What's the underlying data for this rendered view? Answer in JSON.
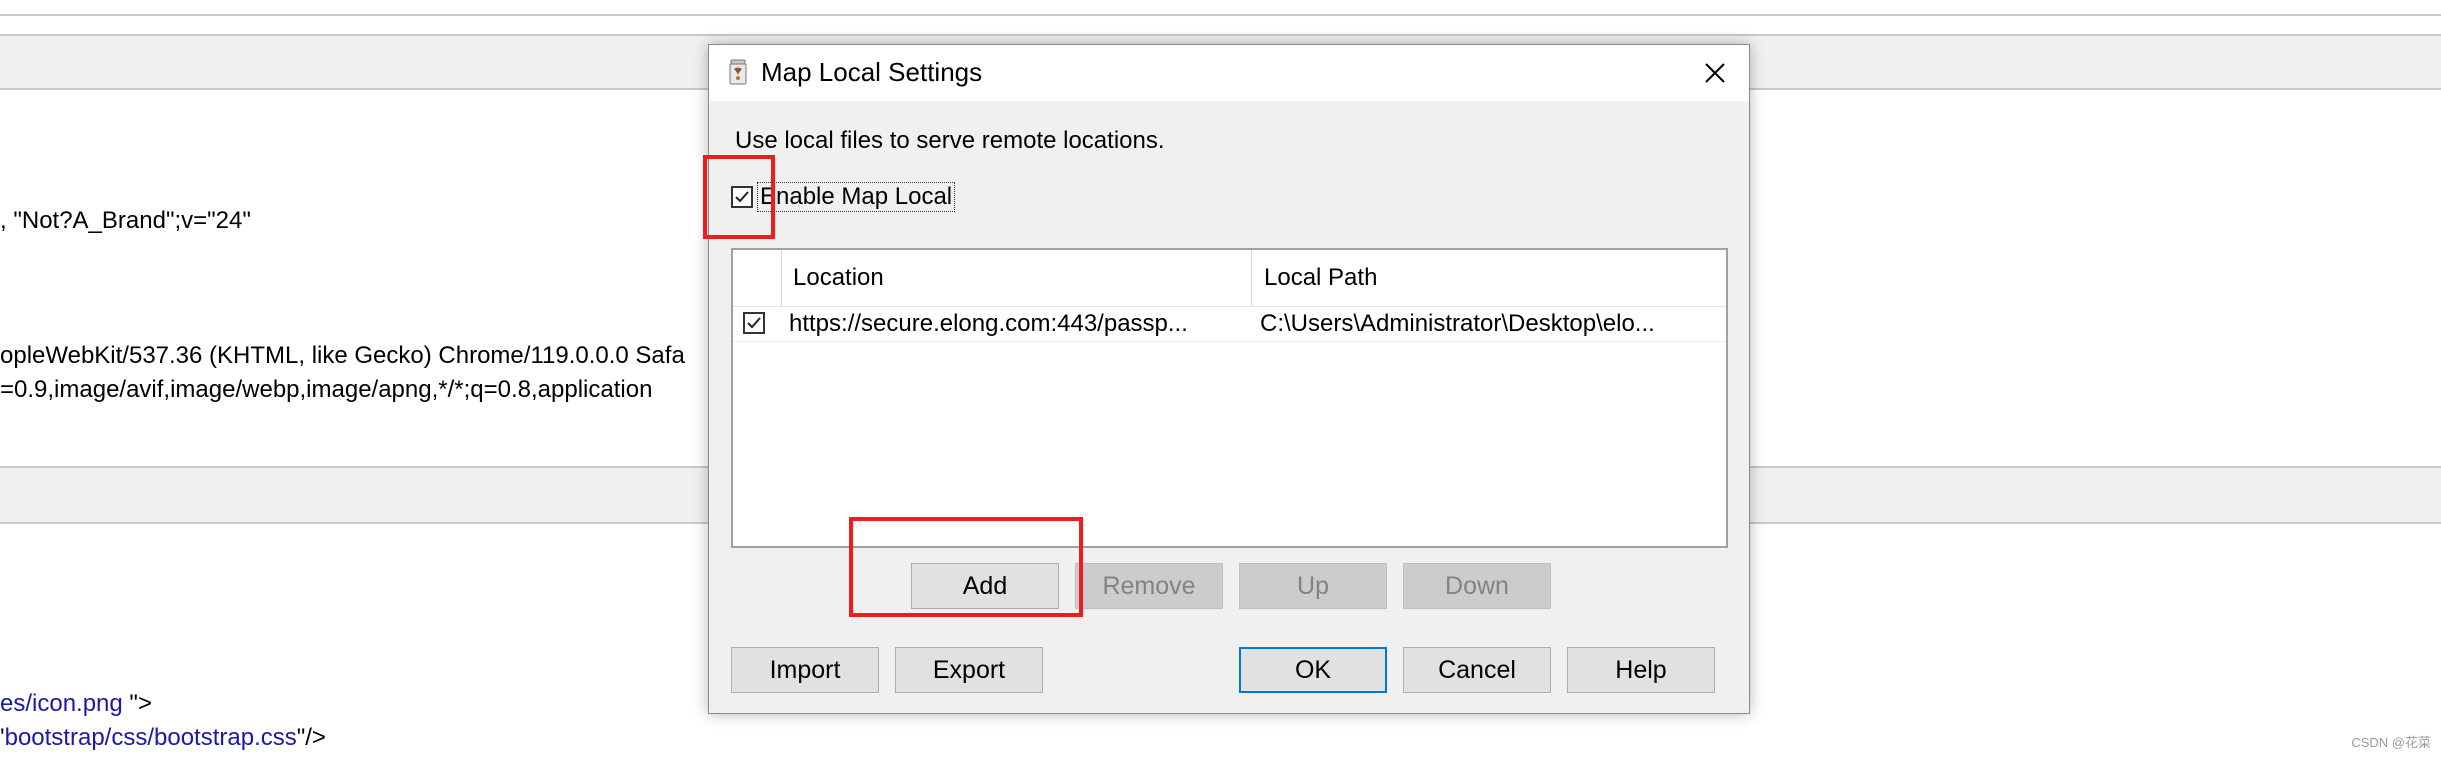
{
  "background": {
    "lines": [
      ", \"Not?A_Brand\";v=\"24\"",
      "opleWebKit/537.36 (KHTML, like Gecko) Chrome/119.0.0.0 Safa",
      "=0.9,image/avif,image/webp,image/apng,*/*;q=0.8,application"
    ],
    "link1": "es/icon.png ",
    "link1_suffix": "\">",
    "link2_prefix": "'",
    "link2": "bootstrap/css/bootstrap.css",
    "link2_suffix": "\"/>",
    "watermark": "CSDN @花菜"
  },
  "dialog": {
    "title": "Map Local Settings",
    "icon": "charles-jar-icon",
    "description": "Use local files to serve remote locations.",
    "enable_label": "Enable Map Local",
    "enable_checked": true,
    "table": {
      "columns": [
        "Location",
        "Local Path"
      ],
      "rows": [
        {
          "checked": true,
          "location": "https://secure.elong.com:443/passp...",
          "local_path": "C:\\Users\\Administrator\\Desktop\\elo..."
        }
      ]
    },
    "buttons": {
      "add": "Add",
      "remove": "Remove",
      "up": "Up",
      "down": "Down",
      "import": "Import",
      "export": "Export",
      "ok": "OK",
      "cancel": "Cancel",
      "help": "Help"
    }
  },
  "colors": {
    "highlight_red": "#ee1c1c",
    "default_button_border": "#0078d7",
    "link_blue": "#1a1aa6"
  }
}
